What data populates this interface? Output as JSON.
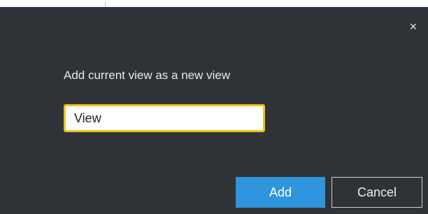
{
  "dialog": {
    "close_glyph": "×",
    "prompt": "Add current view as a new view",
    "input_value": "View",
    "add_label": "Add",
    "cancel_label": "Cancel"
  },
  "icons": {
    "close": "close-icon"
  },
  "colors": {
    "dialog_bg": "#2f3337",
    "input_focus_border": "#f2c21b",
    "primary_button": "#2f95dc"
  }
}
